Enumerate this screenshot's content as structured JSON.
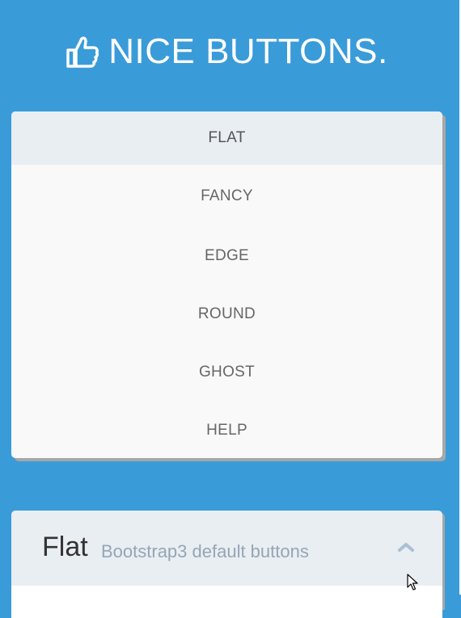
{
  "header": {
    "icon": "thumbs-up-icon",
    "title": "NICE BUTTONS."
  },
  "menu": {
    "items": [
      {
        "label": "FLAT",
        "active": true
      },
      {
        "label": "FANCY",
        "active": false
      },
      {
        "label": "EDGE",
        "active": false
      },
      {
        "label": "ROUND",
        "active": false
      },
      {
        "label": "GHOST",
        "active": false
      },
      {
        "label": "HELP",
        "active": false
      }
    ]
  },
  "panel": {
    "title": "Flat",
    "subtitle": "Bootstrap3 default buttons",
    "toggle_icon": "chevron-up-icon"
  },
  "colors": {
    "background": "#3a9bd9",
    "card": "#f9f9f9",
    "active_item": "#e9eef2",
    "shadow": "#a7a7a7",
    "subtitle": "#95a5b5"
  }
}
